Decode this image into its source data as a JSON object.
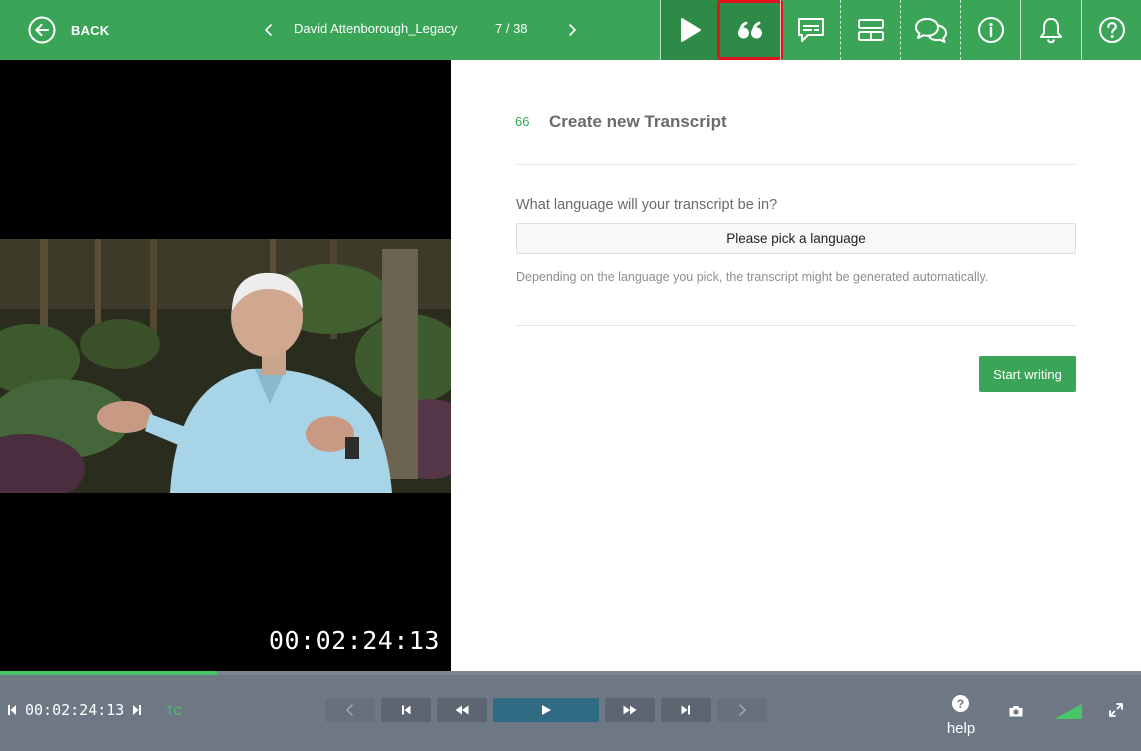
{
  "topbar": {
    "back_label": "BACK",
    "document_title": "David Attenborough_Legacy",
    "document_position": "7 / 38",
    "tools": [
      {
        "name": "play-icon",
        "selected": false
      },
      {
        "name": "quote-icon",
        "selected": true
      },
      {
        "name": "subtitles-icon",
        "selected": false
      },
      {
        "name": "layout-icon",
        "selected": false
      },
      {
        "name": "comments-icon",
        "selected": false
      },
      {
        "name": "info-icon",
        "selected": false
      },
      {
        "name": "bell-icon",
        "selected": false
      },
      {
        "name": "help-icon",
        "selected": false
      }
    ]
  },
  "video": {
    "timecode": "00:02:24:13"
  },
  "panel": {
    "quote_glyph": "66",
    "title": "Create new Transcript",
    "question": "What language will your transcript be in?",
    "language_placeholder": "Please pick a language",
    "hint": "Depending on the language you pick, the transcript might be generated automatically.",
    "start_button": "Start writing"
  },
  "player": {
    "timecode": "00:02:24:13",
    "timecode_mode": "TC",
    "progress": 0.19,
    "help_label": "help",
    "help_glyph": "?",
    "controls": [
      "previous",
      "skip-to-start",
      "rewind",
      "play",
      "fast-forward",
      "skip-to-end",
      "next"
    ]
  },
  "colors": {
    "brand_green": "#3aa557",
    "selected_outline": "#e0141e",
    "player_bg": "#6e7884",
    "progress": "#49c469",
    "play_button": "#2f6b82"
  }
}
